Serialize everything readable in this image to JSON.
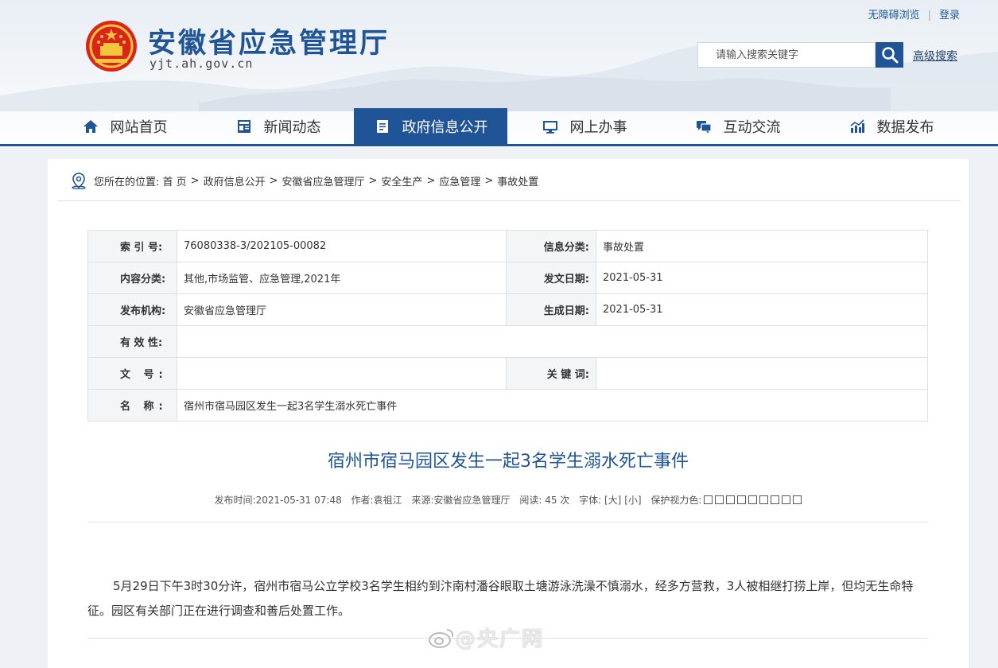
{
  "header": {
    "site_title": "安徽省应急管理厅",
    "site_domain": "yjt.ah.gov.cn",
    "top_links": {
      "accessibility": "无障碍浏览",
      "login": "登录"
    },
    "search": {
      "placeholder": "请输入搜索关键字",
      "advanced": "高级搜索"
    },
    "brand_color": "#1f5597"
  },
  "nav": [
    {
      "label": "网站首页",
      "icon": "home-icon"
    },
    {
      "label": "新闻动态",
      "icon": "news-icon"
    },
    {
      "label": "政府信息公开",
      "icon": "document-icon",
      "active": true
    },
    {
      "label": "网上办事",
      "icon": "monitor-icon"
    },
    {
      "label": "互动交流",
      "icon": "chat-icon"
    },
    {
      "label": "数据发布",
      "icon": "chart-icon"
    }
  ],
  "breadcrumb": {
    "prefix": "您所在的位置:",
    "items": [
      "首 页",
      "政府信息公开",
      "安徽省应急管理厅",
      "安全生产",
      "应急管理",
      "事故处置"
    ]
  },
  "info": {
    "index_label": "索 引 号:",
    "index_value": "76080338-3/202105-00082",
    "category_label": "信息分类:",
    "category_value": "事故处置",
    "content_label": "内容分类:",
    "content_value": "其他,市场监管、应急管理,2021年",
    "pub_date_label": "发文日期:",
    "pub_date_value": "2021-05-31",
    "org_label": "发布机构:",
    "org_value": "安徽省应急管理厅",
    "gen_date_label": "生成日期:",
    "gen_date_value": "2021-05-31",
    "validity_label": "有 效 性:",
    "validity_value": "",
    "doc_no_label": "文 号:",
    "doc_no_value": "",
    "keywords_label": "关 键 词:",
    "keywords_value": "",
    "name_label": "名 称:",
    "name_value": "宿州市宿马园区发生一起3名学生溺水死亡事件"
  },
  "article": {
    "title": "宿州市宿马园区发生一起3名学生溺水死亡事件",
    "meta": {
      "time_label": "发布时间:",
      "time_value": "2021-05-31 07:48",
      "author_label": "作者:",
      "author_value": "袁祖江",
      "source_label": "来源:",
      "source_value": "安徽省应急管理厅",
      "reads_label": "阅读:",
      "reads_value": "45 次",
      "font_label": "字体:",
      "font_big": "[大]",
      "font_small": "[小]",
      "eye_label": "保护视力色:"
    },
    "body": "5月29日下午3时30分许，宿州市宿马公立学校3名学生相约到汴南村潘谷眼取土塘游泳洗澡不慎溺水，经多方营救，3人被相继打捞上岸，但均无生命特征。园区有关部门正在进行调查和善后处置工作。"
  },
  "watermark": "@央广网"
}
